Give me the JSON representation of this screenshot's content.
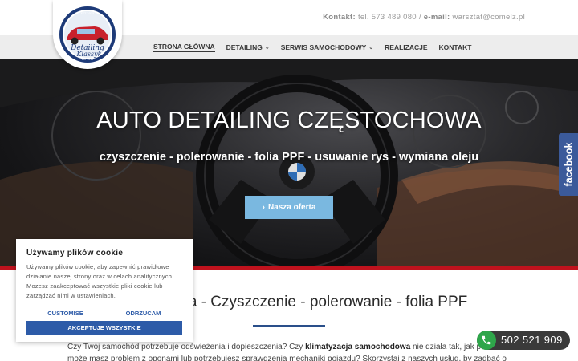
{
  "header": {
    "contact_label": "Kontakt:",
    "phone_text": "tel. 573 489 080",
    "sep": "/",
    "email_label": "e-mail:",
    "email_text": "warsztat@comelz.pl"
  },
  "logo": {
    "text_top": "EST 2015",
    "text_main_1": "Detailing",
    "text_main_2": "Klassyk",
    "text_bottom": "EST 2015"
  },
  "nav": {
    "items": [
      {
        "label": "STRONA GŁÓWNA",
        "active": true,
        "dropdown": false
      },
      {
        "label": "DETAILING",
        "active": false,
        "dropdown": true
      },
      {
        "label": "SERWIS SAMOCHODOWY",
        "active": false,
        "dropdown": true
      },
      {
        "label": "REALIZACJE",
        "active": false,
        "dropdown": false
      },
      {
        "label": "KONTAKT",
        "active": false,
        "dropdown": false
      }
    ],
    "dropdown_icon": "chevron-down-icon"
  },
  "hero": {
    "title": "AUTO DETAILING CZĘSTOCHOWA",
    "subtitle": "czyszczenie - polerowanie - folia PPF - usuwanie rys - wymiana oleju",
    "button_label": "Nasza oferta",
    "button_icon": "chevron-right-icon",
    "accent_color": "#c0121d",
    "button_color": "#7ab8e0"
  },
  "facebook_tab": {
    "label": "facebook",
    "color": "#3b5a9a"
  },
  "content": {
    "title": "howa - Czyszczenie - polerowanie - folia PPF",
    "paragraph_part1": "Czy Twój samochód potrzebuje odświeżenia i dopieszczenia? Czy ",
    "paragraph_bold": "klimatyzacja samochodowa",
    "paragraph_part2": " nie działa tak, jak po",
    "paragraph_line2": "może masz problem z oponami lub potrzebujesz sprawdzenia mechaniki pojazdu? Skorzystaj z naszych usług, by zadbać o"
  },
  "cookie": {
    "title": "Używamy plików cookie",
    "text": "Używamy plików cookie, aby zapewnić prawidłowe działanie naszej strony oraz w celach analitycznych. Mozesz zaakceptować wszystkie pliki cookie lub zarządzać nimi w ustawieniach.",
    "customise_label": "CUSTOMISE",
    "reject_label": "ODRZUCAM",
    "accept_label": "AKCEPTUJE WSZYSTKIE",
    "accent_color": "#2d5ba8"
  },
  "phone_button": {
    "number": "502 521 909",
    "icon": "phone-icon",
    "icon_color": "#2ea64a"
  }
}
